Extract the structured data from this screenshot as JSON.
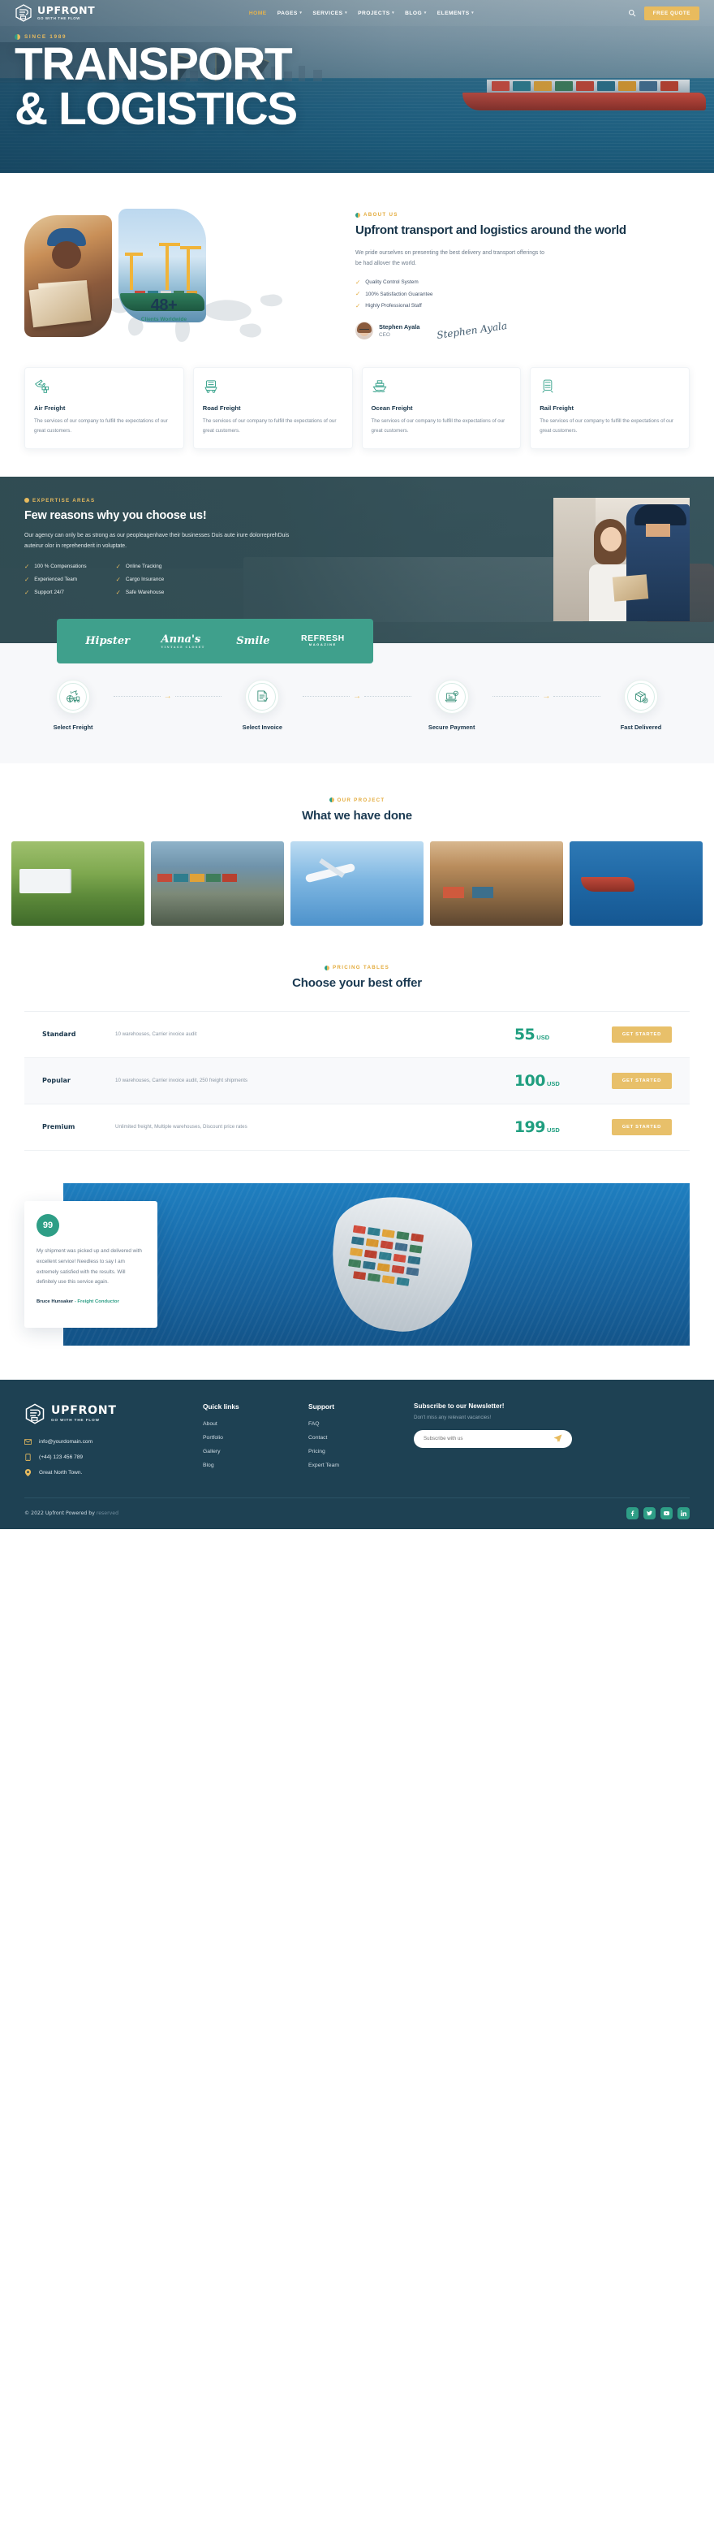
{
  "brand": {
    "name": "UPFRONT",
    "tagline": "GO WITH THE FLOW",
    "logo_icon": "upfront-hexagon-logo-icon"
  },
  "nav": {
    "items": [
      {
        "label": "HOME",
        "has_caret": false,
        "active": true
      },
      {
        "label": "PAGES",
        "has_caret": true,
        "active": false
      },
      {
        "label": "SERVICES",
        "has_caret": true,
        "active": false
      },
      {
        "label": "PROJECTS",
        "has_caret": true,
        "active": false
      },
      {
        "label": "BLOG",
        "has_caret": true,
        "active": false
      },
      {
        "label": "ELEMENTS",
        "has_caret": true,
        "active": false
      }
    ],
    "search_icon": "search-icon",
    "cta_label": "FREE QUOTE"
  },
  "hero": {
    "eyebrow": "SINCE 1989",
    "title_line1": "TRANSPORT",
    "title_line2": "& LOGISTICS"
  },
  "about": {
    "eyebrow": "ABOUT US",
    "title": "Upfront transport and logistics around the world",
    "description": "We pride ourselves on presenting the best delivery and transport offerings to be had allover the world.",
    "checks": [
      "Quality Control System",
      "100% Satisfaction Guarantee",
      "Highly Professional Staff"
    ],
    "counter_number": "48+",
    "counter_label": "Clients Worldwide",
    "ceo_name": "Stephen Ayala",
    "ceo_role": "CEO",
    "signature": "Stephen Ayala"
  },
  "services": [
    {
      "icon": "air-freight-plane-icon",
      "title": "Air Freight",
      "desc": "The services of our company to fulfill the expectations of our great customers."
    },
    {
      "icon": "road-freight-truck-icon",
      "title": "Road Freight",
      "desc": "The services of our company to fulfill the expectations of our great customers."
    },
    {
      "icon": "ocean-freight-ship-icon",
      "title": "Ocean Freight",
      "desc": "The services of our company to fulfill the expectations of our great customers."
    },
    {
      "icon": "rail-freight-train-icon",
      "title": "Rail Freight",
      "desc": "The services of our company to fulfill the expectations of our great customers."
    }
  ],
  "expertise": {
    "eyebrow": "EXPERTISE AREAS",
    "title": "Few reasons why you choose us!",
    "description": "Our agency can only be as strong as our peopleagenhave their businesses Duis aute irure dolorreprehDuis auteirur olor in reprehenderit in voluptate.",
    "checks_left": [
      "100 % Compensations",
      "Experienced Team",
      "Support 24/7"
    ],
    "checks_right": [
      "Online Tracking",
      "Cargo Insurance",
      "Safe Warehouse"
    ]
  },
  "brand_strip": [
    {
      "name": "Hipster",
      "sub": ""
    },
    {
      "name": "Anna's",
      "sub": "VINTAGE CLOSET"
    },
    {
      "name": "Smile",
      "sub": ""
    },
    {
      "name": "REFRESH",
      "sub": "MAGAZINE"
    }
  ],
  "process": {
    "steps": [
      {
        "icon": "global-freight-icon",
        "label": "Select Freight"
      },
      {
        "icon": "invoice-document-icon",
        "label": "Select Invoice"
      },
      {
        "icon": "secure-payment-laptop-icon",
        "label": "Secure Payment"
      },
      {
        "icon": "fast-delivery-box-icon",
        "label": "Fast Delivered"
      }
    ],
    "arrow_glyph": "→"
  },
  "projects": {
    "eyebrow": "OUR PROJECT",
    "title": "What we have done",
    "items": [
      {
        "name": "truck-fleet-project"
      },
      {
        "name": "rail-container-project"
      },
      {
        "name": "air-cargo-project"
      },
      {
        "name": "port-crane-project"
      },
      {
        "name": "container-ship-project"
      }
    ]
  },
  "pricing": {
    "eyebrow": "PRICING TABLES",
    "title": "Choose your best offer",
    "cta_label": "GET STARTED",
    "plans": [
      {
        "name": "Standard",
        "features": "10 warehouses, Carrier invoice audit",
        "amount": "55",
        "currency": "USD",
        "highlight": false
      },
      {
        "name": "Popular",
        "features": "10 warehouses, Carrier invoice audit, 250 freight shipments",
        "amount": "100",
        "currency": "USD",
        "highlight": true
      },
      {
        "name": "Premium",
        "features": "Unlimited freight, Multiple warehouses, Discount price rates",
        "amount": "199",
        "currency": "USD",
        "highlight": false
      }
    ]
  },
  "testimonial": {
    "badge": "99",
    "text": "My shipment was picked up and delivered with excellent service! Needless to say I am extremely satisfied with the results. Will definitely use this service again.",
    "author": "Bruce Hunsaker",
    "role": "- Freight Conductor"
  },
  "footer": {
    "contacts": [
      {
        "icon": "envelope-icon",
        "text": "info@yourdomain.com"
      },
      {
        "icon": "phone-icon",
        "text": "(+44) 123 456 789"
      },
      {
        "icon": "location-pin-icon",
        "text": "Great North Town."
      }
    ],
    "quick_links": {
      "heading": "Quick links",
      "items": [
        "About",
        "Portfolio",
        "Gallery",
        "Blog"
      ]
    },
    "support": {
      "heading": "Support",
      "items": [
        "FAQ",
        "Contact",
        "Pricing",
        "Expert Team"
      ]
    },
    "newsletter": {
      "title": "Subscribe to our Newsletter!",
      "subtitle": "Don't miss any relevant vacancies!",
      "placeholder": "Subscribe with us",
      "value": "",
      "send_icon": "paper-plane-send-icon"
    },
    "copyright": "© 2022 Upfront Powered by",
    "copyright_muted": "reserved",
    "socials": [
      "facebook-icon",
      "twitter-icon",
      "youtube-icon",
      "linkedin-icon"
    ]
  },
  "colors": {
    "accent_gold": "#e8bb5e",
    "accent_teal": "#2e9e86",
    "dark_navy": "#1e4153",
    "heading": "#173449"
  }
}
